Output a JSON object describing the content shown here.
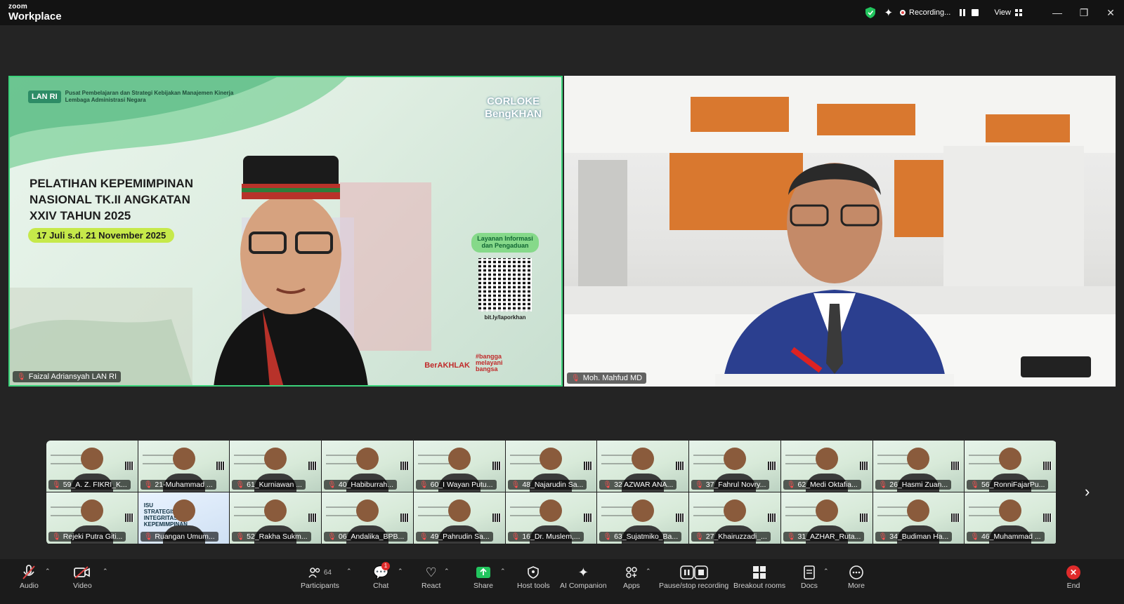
{
  "app": {
    "brand_small": "zoom",
    "brand_name": "Workplace"
  },
  "titlebar": {
    "recording_label": "Recording...",
    "view_label": "View",
    "minimize": "—",
    "restore": "❐",
    "close": "✕"
  },
  "speaker1": {
    "name": "Faizal Adriansyah LAN RI",
    "slide": {
      "logo": "LAN RI",
      "org_line1": "Pusat Pembelajaran dan Strategi Kebijakan Manajemen Kinerja",
      "org_line2": "Lembaga Administrasi Negara",
      "title": "PELATIHAN KEPEMIMPINAN NASIONAL TK.II ANGKATAN XXIV TAHUN 2025",
      "date": "17 Juli s.d. 21 November 2025",
      "map_text1": "CORLOKE",
      "map_text2": "BengKHAN",
      "qr_pill": "Layanan Informasi dan Pengaduan",
      "qr_url": "bit.ly/laporkhan",
      "berakhlak": "BerAKHLAK",
      "bangga": "#bangga melayani bangsa"
    }
  },
  "speaker2": {
    "name": "Moh. Mahfud MD"
  },
  "gallery": [
    "59_A. Z. FIKRI_K...",
    "21-Muhammad ...",
    "61_Kurniawan ...",
    "40_Habiburrah...",
    "60_I Wayan Putu...",
    "48_Najarudin Sa...",
    "32 AZWAR ANA...",
    "37_Fahrul Novry...",
    "62_Medi Oktafia...",
    "26_Hasmi Zuan...",
    "56_RonniFajarPu...",
    "Rejeki Putra Giti...",
    "Ruangan Umum...",
    "52_Rakha Sukm...",
    "06_Andalika_BPB...",
    "49_Pahrudin Sa...",
    "16_Dr. Muslem,...",
    "63_Sujatmiko_Ba...",
    "27_Khairuzzadi_...",
    "31_AZHAR_Ruta...",
    "34_Budiman Ha...",
    "46_Muhammad ..."
  ],
  "gallery_special_slide": "ISU STRATEGIS: INTEGRITAS KEPEMIMPINAN",
  "toolbar": {
    "audio": "Audio",
    "video": "Video",
    "participants": "Participants",
    "participants_count": "64",
    "chat": "Chat",
    "chat_badge": "1",
    "react": "React",
    "share": "Share",
    "host_tools": "Host tools",
    "ai_companion": "AI Companion",
    "apps": "Apps",
    "pause_stop": "Pause/stop recording",
    "breakout": "Breakout rooms",
    "docs": "Docs",
    "more": "More",
    "end": "End"
  },
  "colors": {
    "active_speaker_border": "#3bd37a",
    "end_button": "#e02b2b",
    "share_green": "#22c55e"
  }
}
